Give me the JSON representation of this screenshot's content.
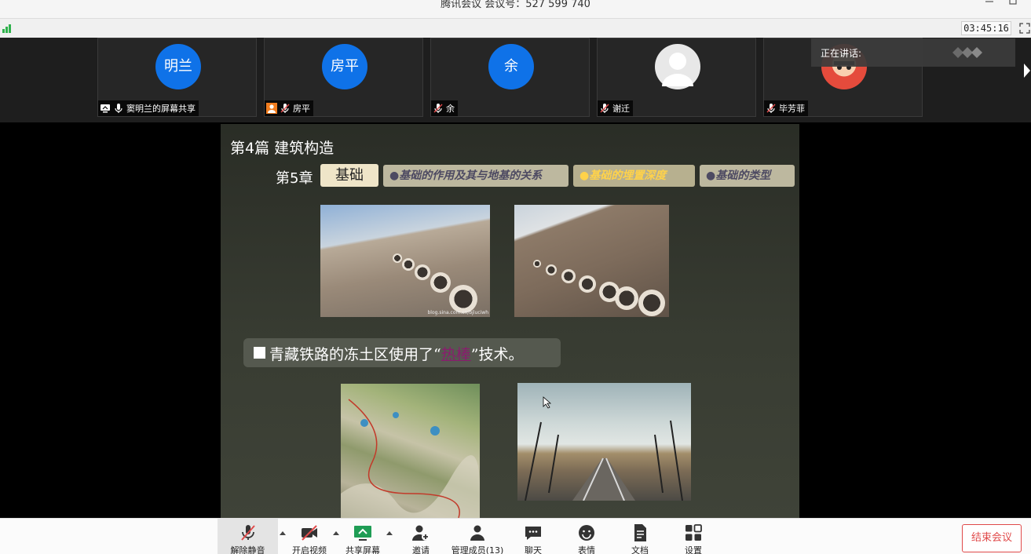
{
  "window": {
    "title": "腾讯会议 会议号：527 599 740"
  },
  "status": {
    "timer": "03:45:16"
  },
  "participants": [
    {
      "avatar_text": "明兰",
      "label": "窦明兰的屏幕共享",
      "avatar_color": "#0f72e8"
    },
    {
      "avatar_text": "房平",
      "label": "房平",
      "avatar_color": "#0f72e8"
    },
    {
      "avatar_text": "余",
      "label": "余",
      "avatar_color": "#0f72e8"
    },
    {
      "avatar_text": "",
      "label": "谢迁",
      "avatar_color": "#e8e8e8"
    },
    {
      "avatar_text": "",
      "label": "毕芳菲",
      "avatar_color": "#e54b3c"
    }
  ],
  "speaking": {
    "label": "正在讲话:"
  },
  "slide": {
    "part_title": "第4篇  建筑构造",
    "chapter": "第5章",
    "active_tab": "基础",
    "tabs": [
      "●基础的作用及其与地基的关系",
      "●基础的埋置深度",
      "●基础的类型"
    ],
    "bullet_before": "青藏铁路的冻土区使用了“",
    "bullet_highlight": "热棒",
    "bullet_after": "”技术。",
    "watermark": "blog.sina.com.cn/bjluciwh"
  },
  "toolbar": {
    "unmute": "解除静音",
    "video": "开启视频",
    "share": "共享屏幕",
    "invite": "邀请",
    "members": "管理成员(13)",
    "chat": "聊天",
    "emoji": "表情",
    "docs": "文档",
    "settings": "设置",
    "end": "结束会议"
  },
  "colors": {
    "accent": "#0f72e8",
    "danger": "#e04a4a",
    "signal": "#2fb24c",
    "highlight_tab": "#ffd24a",
    "highlight_text": "#8a1c6e"
  }
}
